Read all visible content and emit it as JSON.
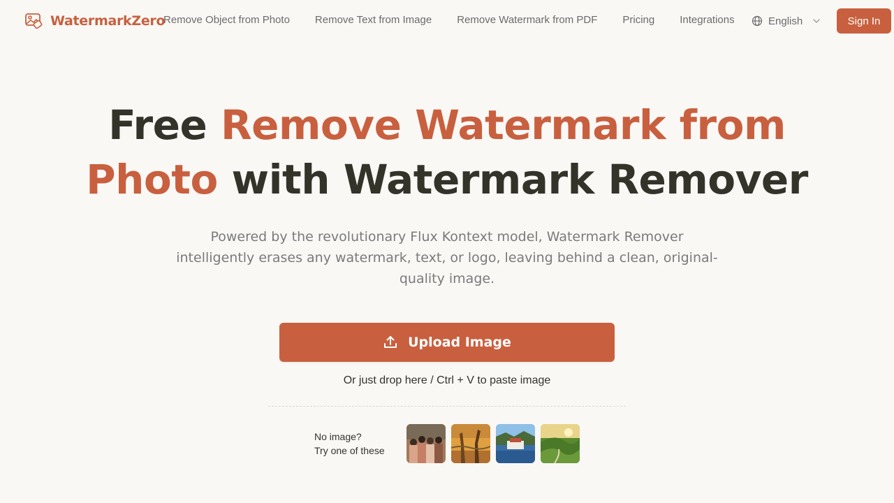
{
  "brand": {
    "name": "WatermarkZero",
    "logo_icon": "image-eraser-icon",
    "accent_color": "#c8603f"
  },
  "nav": {
    "links": [
      "Remove Object from Photo",
      "Remove Text from Image",
      "Remove Watermark from PDF",
      "Pricing",
      "Integrations"
    ]
  },
  "language": {
    "icon": "globe-icon",
    "value": "English",
    "chevron": "chevron-down-icon"
  },
  "auth": {
    "sign_in_label": "Sign In"
  },
  "hero": {
    "title_part1": "Free ",
    "title_accent1": "Remove Watermark from",
    "title_accent2": "Photo",
    "title_part2": " with Watermark Remover",
    "subtitle": "Powered by the revolutionary Flux Kontext model, Watermark Remover intelligently erases any watermark, text, or logo, leaving behind a clean, original-quality image."
  },
  "upload": {
    "icon": "upload-icon",
    "label": "Upload Image",
    "hint": "Or just drop here / Ctrl + V to paste image"
  },
  "samples": {
    "line1": "No image?",
    "line2": "Try one of these",
    "thumbnails": [
      "sample-group-photo",
      "sample-giraffes",
      "sample-coastal-town",
      "sample-green-valley"
    ]
  },
  "colors": {
    "background": "#faf8f5",
    "primary": "#c8603f",
    "heading": "#33332a",
    "muted": "#7a7a7a"
  }
}
